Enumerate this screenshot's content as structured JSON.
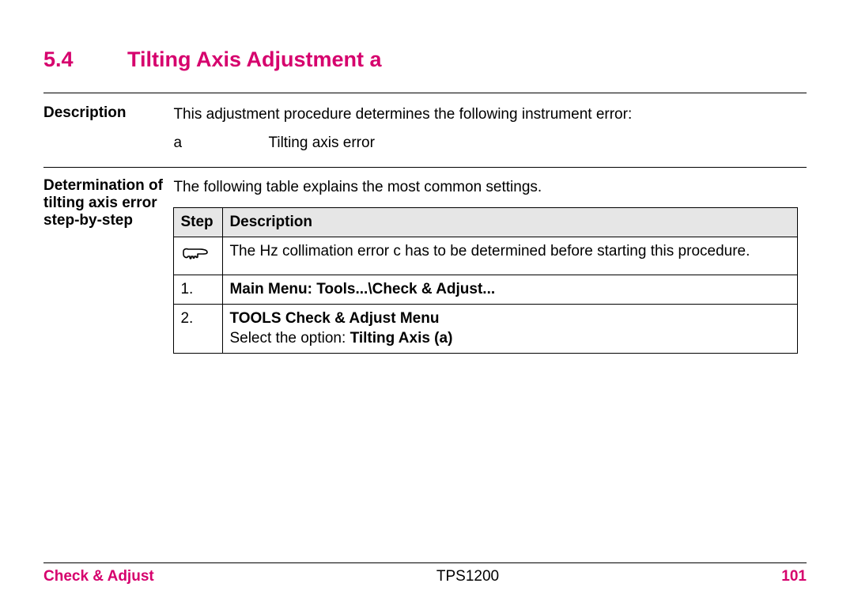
{
  "section": {
    "number": "5.4",
    "title": "Tilting Axis Adjustment a"
  },
  "description": {
    "label": "Description",
    "text": "This adjustment procedure determines the following instrument error:",
    "error_key": "a",
    "error_value": "Tilting axis error"
  },
  "determination": {
    "label": "Determination of tilting axis error step-by-step",
    "intro": "The following table explains the most common settings.",
    "table": {
      "headers": {
        "step": "Step",
        "desc": "Description"
      },
      "rows": [
        {
          "step_icon": "hand",
          "desc": "The Hz collimation error c has to be determined before starting this procedure."
        },
        {
          "step": "1.",
          "desc_bold": "Main Menu: Tools...\\Check & Adjust..."
        },
        {
          "step": "2.",
          "desc_bold": "TOOLS Check & Adjust Menu",
          "desc_plain_prefix": "Select the option: ",
          "desc_plain_bold": "Tilting Axis (a)"
        }
      ]
    }
  },
  "footer": {
    "left": "Check & Adjust",
    "mid": "TPS1200",
    "right": "101"
  }
}
